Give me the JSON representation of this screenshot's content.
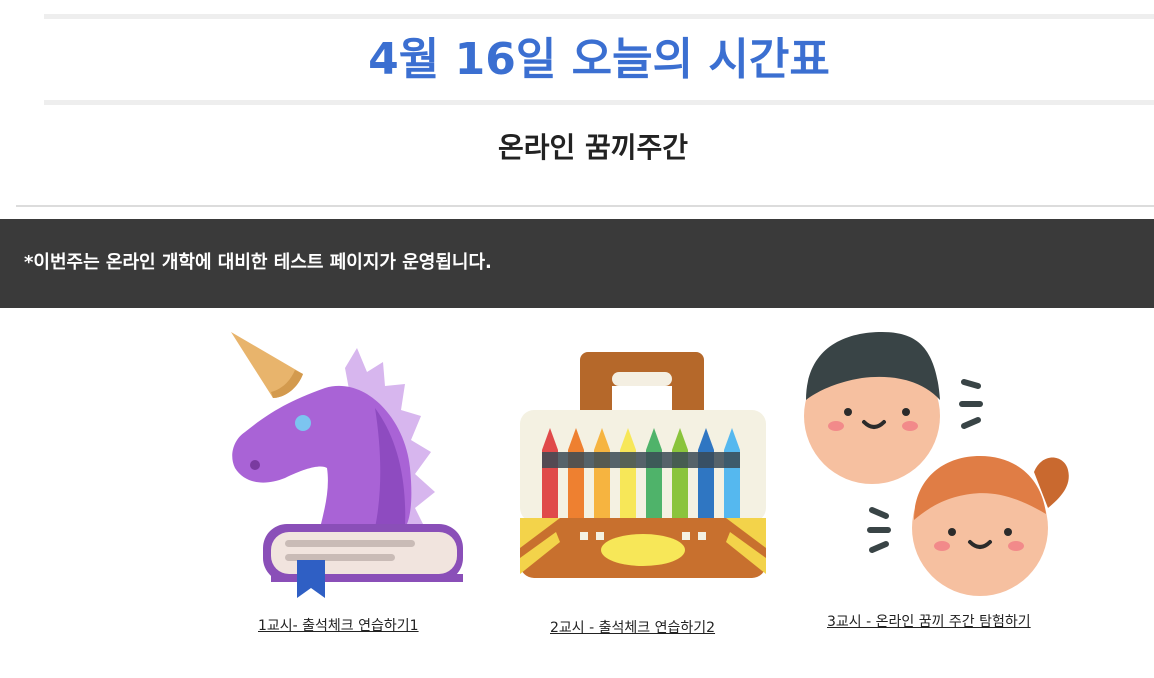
{
  "header": {
    "title": "4월 16일 오늘의 시간표",
    "subtitle": "온라인 꿈끼주간"
  },
  "notice": {
    "text": "*이번주는 온라인 개학에 대비한 테스트 페이지가 운영됩니다."
  },
  "colors": {
    "title": "#3b6fd1",
    "notice_bg": "#3a3a3a"
  },
  "lessons": [
    {
      "label": "1교시- 출석체크 연습하기1",
      "icon": "unicorn-book-icon"
    },
    {
      "label": "2교시 - 출석체크 연습하기2",
      "icon": "crayon-box-icon"
    },
    {
      "label": "3교시 - 온라인 꿈끼 주간 탐험하기",
      "icon": "boy-girl-faces-icon"
    }
  ]
}
